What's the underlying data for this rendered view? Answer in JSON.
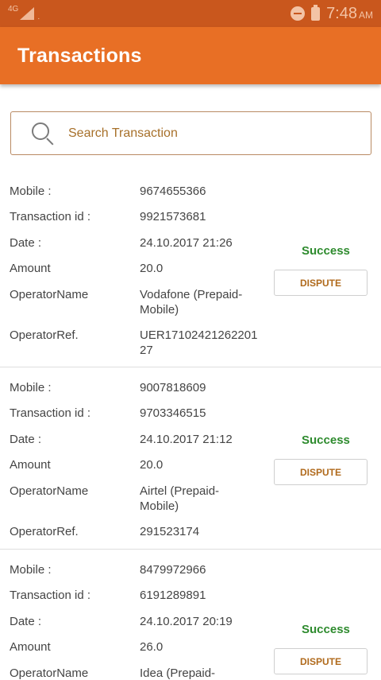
{
  "status_bar": {
    "network": "4G",
    "time": "7:48",
    "ampm": "AM"
  },
  "header": {
    "title": "Transactions"
  },
  "search": {
    "placeholder": "Search Transaction"
  },
  "labels": {
    "mobile": "Mobile :",
    "transaction_id": "Transaction id :",
    "date": "Date :",
    "amount": "Amount",
    "operator_name": "OperatorName",
    "operator_ref": "OperatorRef.",
    "dispute": "DISPUTE"
  },
  "transactions": [
    {
      "mobile": "9674655366",
      "transaction_id": "9921573681",
      "date": "24.10.2017 21:26",
      "amount": "20.0",
      "operator_name": "Vodafone (Prepaid-Mobile)",
      "operator_ref": "UER1710242126220127",
      "status": "Success"
    },
    {
      "mobile": "9007818609",
      "transaction_id": "9703346515",
      "date": "24.10.2017 21:12",
      "amount": "20.0",
      "operator_name": "Airtel (Prepaid-Mobile)",
      "operator_ref": "291523174",
      "status": "Success"
    },
    {
      "mobile": "8479972966",
      "transaction_id": "6191289891",
      "date": "24.10.2017 20:19",
      "amount": "26.0",
      "operator_name": "Idea (Prepaid-",
      "status": "Success"
    }
  ]
}
